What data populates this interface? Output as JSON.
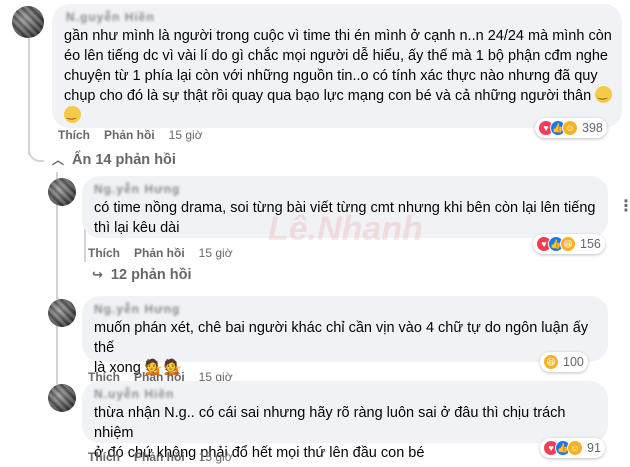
{
  "comments": [
    {
      "author": "N.guyễn Hiền",
      "lines": [
        "gần như mình là người trong cuộc vì time thi én mình ở cạnh n..n 24/24 mà mình còn",
        "éo lên tiếng dc vì vài lí do gì chắc mọi người dễ hiểu, ấy thế mà 1 bộ phận cđm nghe",
        "chuyện từ 1 phía lại còn với những nguồn tin..o có tính xác thực nào nhưng đã quy",
        "chụp cho đó là sự thật rồi quay qua bạo lực mạng con bé và cả những người thân"
      ],
      "like_label": "Thích",
      "reply_label": "Phản hồi",
      "time": "15 giờ",
      "reaction_count": "398"
    },
    {
      "author": "Ng.yễn Hưng",
      "lines": [
        "có time nồng drama, soi từng bài viết từng cmt nhưng khi bên còn lại lên tiếng",
        "thì lại kêu dài"
      ],
      "like_label": "Thích",
      "reply_label": "Phản hồi",
      "time": "15 giờ",
      "reaction_count": "156"
    },
    {
      "author": "Ng.yễn Hưng",
      "lines": [
        "muốn phán xét, chê bai người khác chỉ cần vịn vào 4 chữ tự do ngôn luận ấy thế",
        "là xong"
      ],
      "like_label": "Thích",
      "reply_label": "Phản hồi",
      "time": "15 giờ",
      "reaction_count": "100"
    },
    {
      "author": "N.uyễn Hiền",
      "lines": [
        "thừa nhận N.g.. có cái sai nhưng hãy rõ ràng luôn sai ở đâu thì chịu trách nhiệm",
        "ở đó chứ không phải đổ hết mọi thứ lên đầu con bé"
      ],
      "like_label": "Thích",
      "reply_label": "Phản hồi",
      "time": "15 giờ",
      "reaction_count": "91"
    }
  ],
  "hide_replies_label": "Ẩn 14 phản hồi",
  "more_replies_label": "12 phản hồi",
  "watermark": "Lê.Nhanh"
}
